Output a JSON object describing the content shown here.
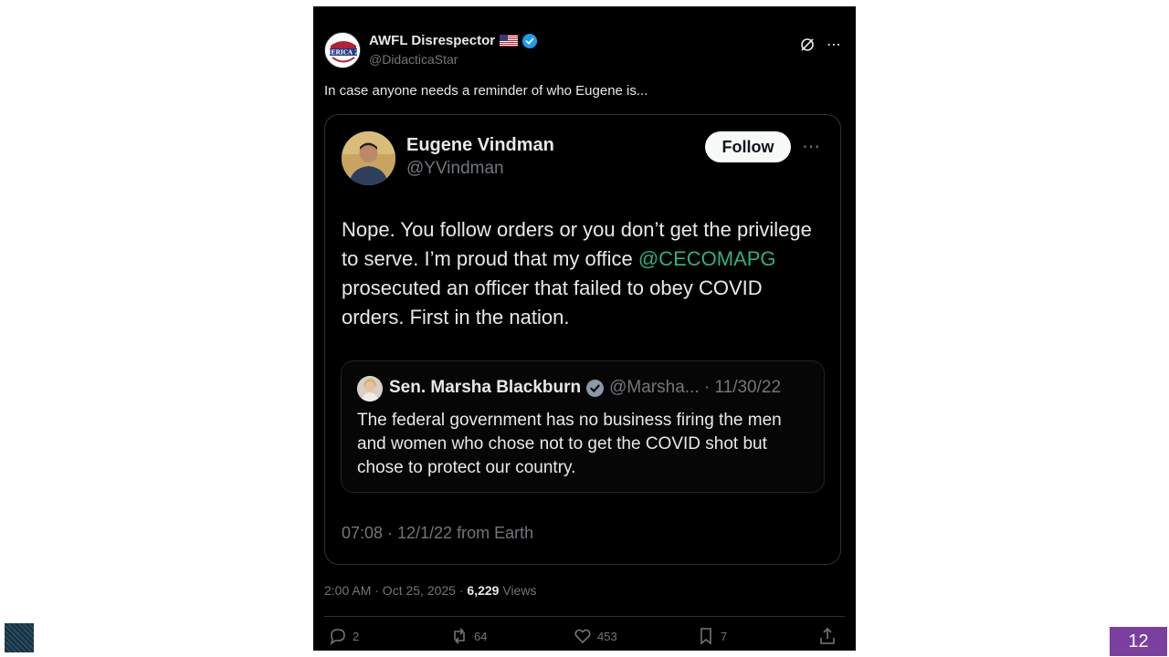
{
  "tweet": {
    "author_name": "AWFL Disrespector",
    "author_handle": "@DidacticaStar",
    "avatar_label": "AMERICA 250",
    "text": "In case anyone needs a reminder of who Eugene is...",
    "timestamp": "2:00 AM · Oct 25, 2025 · ",
    "views_count": "6,229",
    "views_label": " Views",
    "replies": "2",
    "reposts": "64",
    "likes": "453",
    "bookmarks": "7"
  },
  "embedded": {
    "author_name": "Eugene Vindman",
    "author_handle": "@YVindman",
    "follow_label": "Follow",
    "body_part1": "Nope. You follow orders or you don’t get the privilege to serve. I’m proud that my office ",
    "mention": "@CECOMAPG",
    "body_part2": " prosecuted an officer that failed to obey COVID orders. First in the nation.",
    "timestamp": "07:08 · 12/1/22 from Earth",
    "quote": {
      "author_name": "Sen. Marsha Blackburn",
      "author_handle": "@Marsha... · 11/30/22",
      "body": "The federal government has no business firing the men and women who chose not to get the COVID shot but chose to protect our country."
    }
  },
  "slide": {
    "page_number": "12"
  },
  "colors": {
    "mention": "#2fb07a",
    "verified": "#1d9bf0",
    "page_badge": "#7b3fa0"
  }
}
